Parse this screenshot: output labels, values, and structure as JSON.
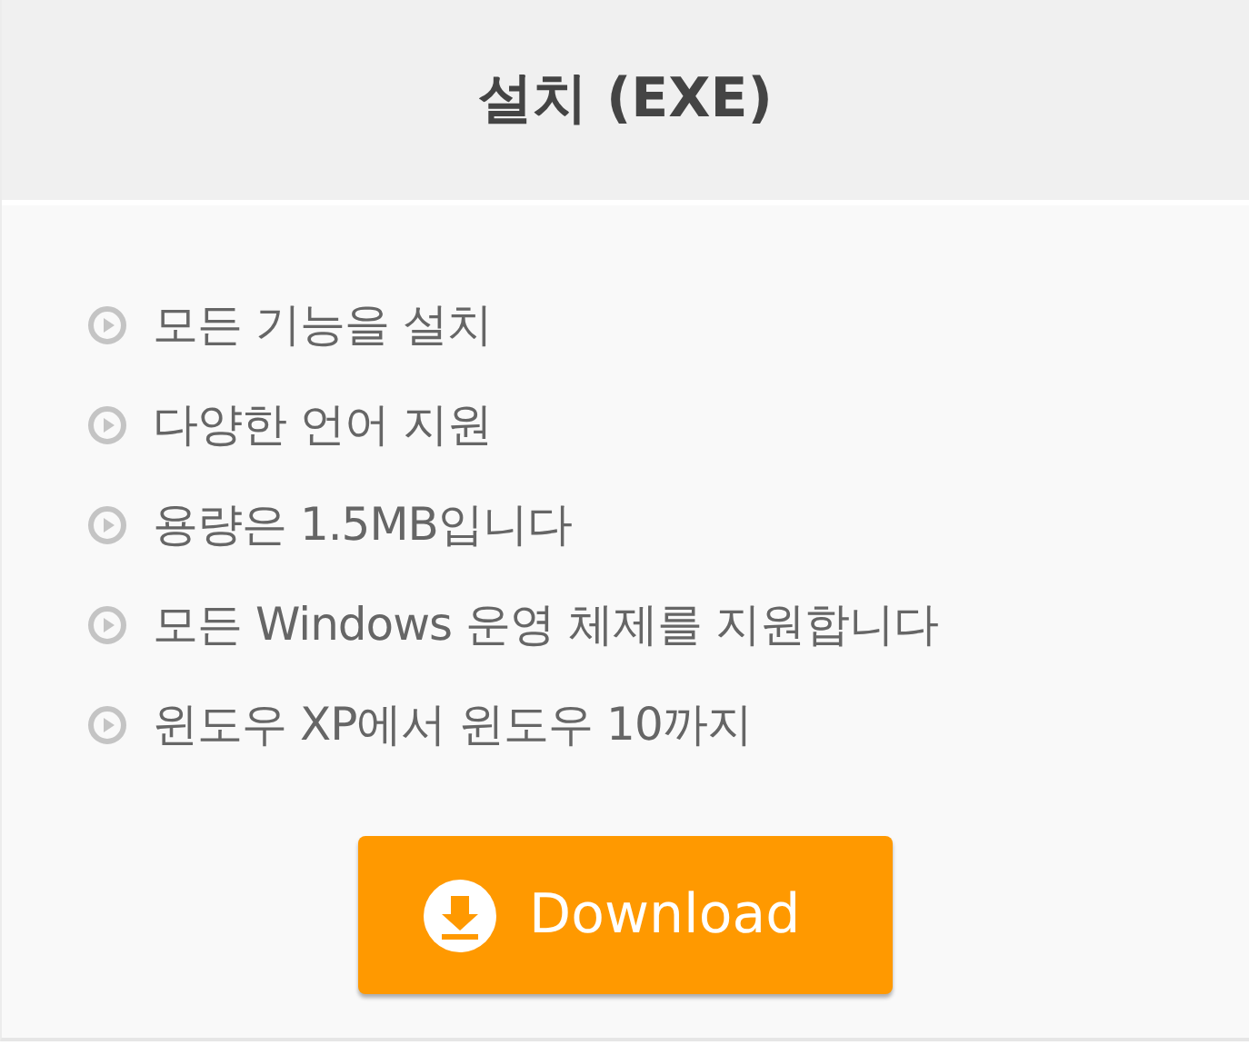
{
  "header": {
    "title": "설치 (EXE)"
  },
  "features": [
    {
      "text": "모든 기능을 설치"
    },
    {
      "text": "다양한 언어 지원"
    },
    {
      "text": "용량은 1.5MB입니다"
    },
    {
      "text": "모든 Windows 운영 체제를 지원합니다"
    },
    {
      "text": "윈도우 XP에서 윈도우 10까지"
    }
  ],
  "download_button": {
    "label": "Download"
  }
}
